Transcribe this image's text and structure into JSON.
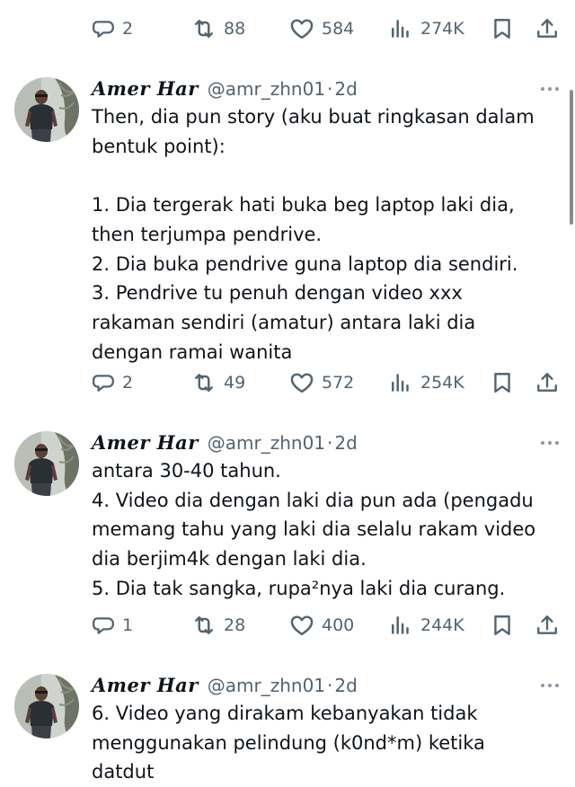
{
  "top_actions": {
    "replies": "2",
    "reposts": "88",
    "likes": "584",
    "views": "274K"
  },
  "tweets": [
    {
      "name": "Amer Har",
      "handle": "@amr_zhn01",
      "separator": "·",
      "time": "2d",
      "text": "Then, dia pun story (aku buat ringkasan dalam\nbentuk point):\n\n1. Dia tergerak hati buka beg laptop laki dia,\nthen terjumpa pendrive.\n2. Dia buka pendrive guna laptop dia sendiri.\n3. Pendrive tu penuh dengan video xxx\nrakaman sendiri (amatur) antara laki dia\ndengan ramai wanita",
      "replies": "2",
      "reposts": "49",
      "likes": "572",
      "views": "254K"
    },
    {
      "name": "Amer Har",
      "handle": "@amr_zhn01",
      "separator": "·",
      "time": "2d",
      "text": "antara 30-40 tahun.\n4. Video dia dengan laki dia pun ada (pengadu\nmemang tahu yang laki dia selalu rakam video\ndia berjim4k dengan laki dia.\n5. Dia tak sangka, rupa²nya laki dia curang.",
      "replies": "1",
      "reposts": "28",
      "likes": "400",
      "views": "244K"
    },
    {
      "name": "Amer Har",
      "handle": "@amr_zhn01",
      "separator": "·",
      "time": "2d",
      "text": "6. Video yang dirakam kebanyakan tidak\nmenggunakan pelindung (k0nd*m) ketika\ndatdut"
    }
  ],
  "icons": {
    "reply": "reply-icon",
    "repost": "repost-icon",
    "like": "heart-icon",
    "views": "views-icon",
    "bookmark": "bookmark-icon",
    "share": "share-icon",
    "more": "more-icon"
  },
  "colors": {
    "text": "#0f1419",
    "secondary": "#536471"
  }
}
